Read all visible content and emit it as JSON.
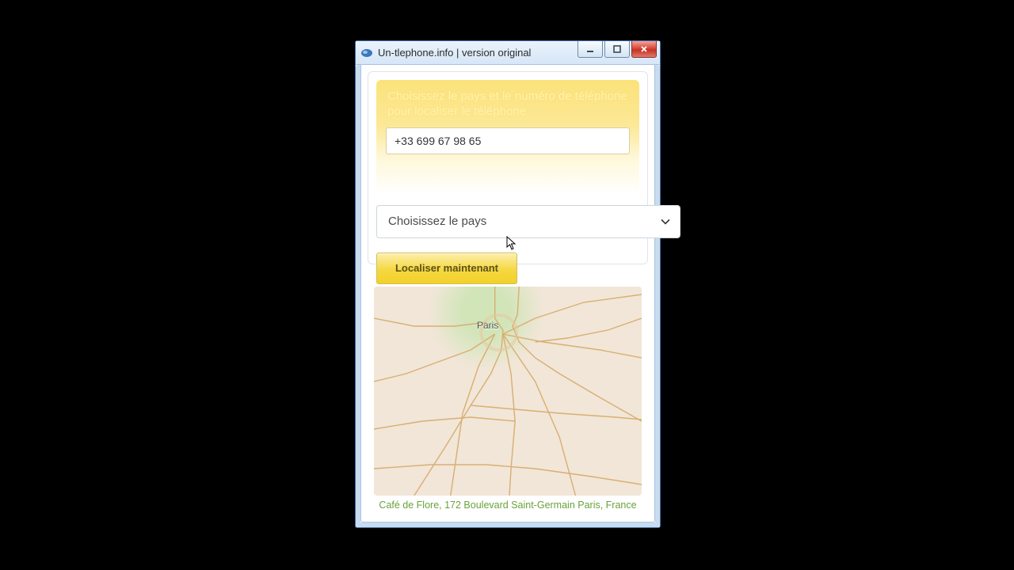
{
  "window": {
    "title": "Un-tlephone.info | version original"
  },
  "form": {
    "instruction": "Choisissez le pays et le numéro de téléphone pour localiser le téléphone",
    "phone_value": "+33 699 67 98 65",
    "country_placeholder": "Choisissez le pays",
    "locate_label": "Localiser maintenant"
  },
  "map": {
    "city_label": "Paris"
  },
  "result": {
    "address": "Café de Flore, 172 Boulevard Saint-Germain Paris, France"
  }
}
